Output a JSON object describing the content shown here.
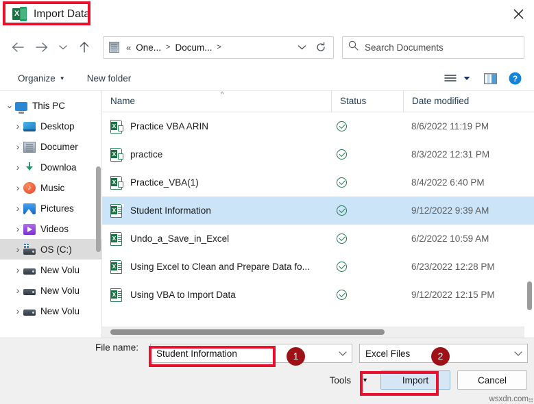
{
  "window": {
    "title": "Import Data",
    "app_icon": "excel-icon",
    "close_label": "×"
  },
  "nav": {
    "back": "back-arrow",
    "forward": "forward-arrow",
    "recent": "recent-dropdown",
    "up": "up-arrow",
    "refresh": "refresh-icon",
    "breadcrumb": {
      "overflow": "«",
      "items": [
        "One...",
        "Docum..."
      ],
      "separator": ">"
    },
    "search": {
      "placeholder": "Search Documents",
      "icon": "search-icon"
    }
  },
  "commandbar": {
    "organize": "Organize",
    "new_folder": "New folder",
    "view_icon": "view-list-icon",
    "pane_icon": "preview-pane-icon",
    "help_icon": "help-icon"
  },
  "sidebar": {
    "items": [
      {
        "label": "This PC",
        "icon": "this-pc-icon",
        "depth": 0,
        "expander": "chevron-down",
        "selected": false
      },
      {
        "label": "Desktop",
        "icon": "desktop-icon",
        "depth": 1,
        "expander": "chevron-right",
        "selected": false
      },
      {
        "label": "Documer",
        "icon": "documents-icon",
        "depth": 1,
        "expander": "chevron-right",
        "selected": false
      },
      {
        "label": "Downloa",
        "icon": "downloads-icon",
        "depth": 1,
        "expander": "chevron-right",
        "selected": false
      },
      {
        "label": "Music",
        "icon": "music-icon",
        "depth": 1,
        "expander": "chevron-right",
        "selected": false
      },
      {
        "label": "Pictures",
        "icon": "pictures-icon",
        "depth": 1,
        "expander": "chevron-right",
        "selected": false
      },
      {
        "label": "Videos",
        "icon": "videos-icon",
        "depth": 1,
        "expander": "chevron-right",
        "selected": false
      },
      {
        "label": "OS (C:)",
        "icon": "os-drive-icon",
        "depth": 1,
        "expander": "chevron-right",
        "selected": true
      },
      {
        "label": "New Volu",
        "icon": "drive-icon",
        "depth": 1,
        "expander": "chevron-right",
        "selected": false
      },
      {
        "label": "New Volu",
        "icon": "drive-icon",
        "depth": 1,
        "expander": "chevron-right",
        "selected": false
      },
      {
        "label": "New Volu",
        "icon": "drive-icon",
        "depth": 1,
        "expander": "chevron-right",
        "selected": false
      }
    ]
  },
  "filelist": {
    "columns": [
      "Name",
      "Status",
      "Date modified"
    ],
    "sort_indicator": "ascending",
    "rows": [
      {
        "name": "Practice VBA ARIN",
        "icon": "excel-shortcut-icon",
        "status": "synced",
        "date": "8/6/2022 11:19 PM",
        "selected": false
      },
      {
        "name": "practice",
        "icon": "excel-shortcut-icon",
        "status": "synced",
        "date": "8/3/2022 12:31 PM",
        "selected": false
      },
      {
        "name": "Practice_VBA(1)",
        "icon": "excel-shortcut-icon",
        "status": "synced",
        "date": "8/4/2022 6:40 PM",
        "selected": false
      },
      {
        "name": "Student Information",
        "icon": "excel-file-icon",
        "status": "synced",
        "date": "9/12/2022 9:39 AM",
        "selected": true
      },
      {
        "name": "Undo_a_Save_in_Excel",
        "icon": "excel-file-icon",
        "status": "synced",
        "date": "6/2/2022 10:59 AM",
        "selected": false
      },
      {
        "name": "Using Excel to Clean and Prepare Data fo...",
        "icon": "excel-file-icon",
        "status": "synced",
        "date": "6/23/2022 12:28 PM",
        "selected": false
      },
      {
        "name": "Using VBA to Import Data",
        "icon": "excel-file-icon",
        "status": "synced",
        "date": "9/12/2022 12:15 PM",
        "selected": false
      }
    ]
  },
  "footer": {
    "filename_label": "File name:",
    "filename_value": "Student Information",
    "filename_placeholder": "File name",
    "filter_value": "Excel Files",
    "tools_label": "Tools",
    "import_label": "Import",
    "cancel_label": "Cancel"
  },
  "annotations": {
    "badge_1": "1",
    "badge_2": "2",
    "box_color": "#e8112d",
    "badge_color": "#9e1116"
  },
  "watermark": "wsxdn.com"
}
